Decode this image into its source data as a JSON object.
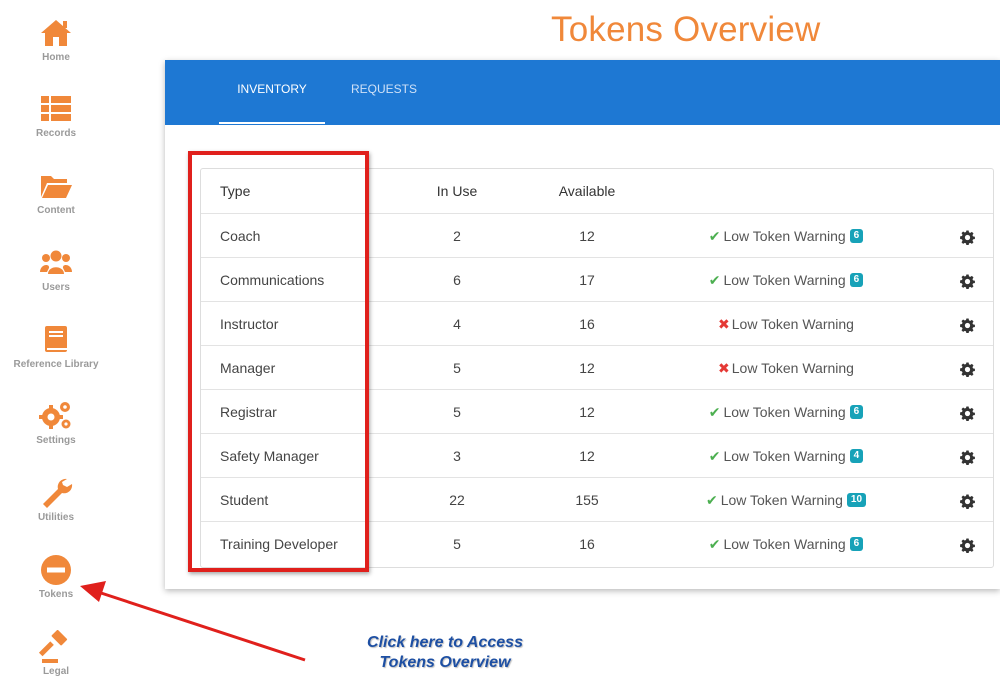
{
  "sidebar": {
    "items": [
      {
        "label": "Home",
        "icon": "home-icon"
      },
      {
        "label": "Records",
        "icon": "list-icon"
      },
      {
        "label": "Content",
        "icon": "folder-icon"
      },
      {
        "label": "Users",
        "icon": "users-icon"
      },
      {
        "label": "Reference Library",
        "icon": "book-icon"
      },
      {
        "label": "Settings",
        "icon": "gears-icon"
      },
      {
        "label": "Utilities",
        "icon": "wrench-icon"
      },
      {
        "label": "Tokens",
        "icon": "minus-circle-icon"
      },
      {
        "label": "Legal",
        "icon": "gavel-icon"
      }
    ],
    "icon_color": "#f0883a"
  },
  "page": {
    "title": "Tokens Overview"
  },
  "tabs": [
    {
      "label": "INVENTORY",
      "active": true
    },
    {
      "label": "REQUESTS",
      "active": false
    }
  ],
  "table": {
    "headers": {
      "type": "Type",
      "in_use": "In Use",
      "available": "Available"
    },
    "rows": [
      {
        "type": "Coach",
        "in_use": "2",
        "available": "12",
        "warning_label": "Low Token Warning",
        "warning_enabled": true,
        "threshold": "6"
      },
      {
        "type": "Communications",
        "in_use": "6",
        "available": "17",
        "warning_label": "Low Token Warning",
        "warning_enabled": true,
        "threshold": "6"
      },
      {
        "type": "Instructor",
        "in_use": "4",
        "available": "16",
        "warning_label": "Low Token Warning",
        "warning_enabled": false,
        "threshold": ""
      },
      {
        "type": "Manager",
        "in_use": "5",
        "available": "12",
        "warning_label": "Low Token Warning",
        "warning_enabled": false,
        "threshold": ""
      },
      {
        "type": "Registrar",
        "in_use": "5",
        "available": "12",
        "warning_label": "Low Token Warning",
        "warning_enabled": true,
        "threshold": "6"
      },
      {
        "type": "Safety Manager",
        "in_use": "3",
        "available": "12",
        "warning_label": "Low Token Warning",
        "warning_enabled": true,
        "threshold": "4"
      },
      {
        "type": "Student",
        "in_use": "22",
        "available": "155",
        "warning_label": "Low Token Warning",
        "warning_enabled": true,
        "threshold": "10"
      },
      {
        "type": "Training Developer",
        "in_use": "5",
        "available": "16",
        "warning_label": "Low Token Warning",
        "warning_enabled": true,
        "threshold": "6"
      }
    ]
  },
  "annotation": {
    "line1": "Click here to Access",
    "line2": "Tokens Overview",
    "color": "#e0201c"
  },
  "colors": {
    "title": "#f0883a",
    "tabbar": "#1e78d3",
    "check": "#4caf50",
    "cross": "#e53935",
    "badge": "#17a2b8"
  }
}
